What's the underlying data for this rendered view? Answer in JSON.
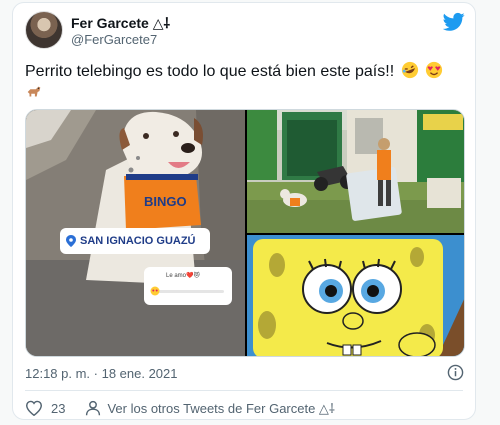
{
  "author": {
    "name": "Fer Garcete △⸸",
    "handle": "@FerGarcete7"
  },
  "tweet": {
    "text": "Perrito telebingo es todo lo que está bien este país!!",
    "emojis": [
      "rolling-on-floor-laughing",
      "heart-eyes",
      "dog"
    ]
  },
  "media": {
    "photo1": {
      "vest_text": "BINGO",
      "location_sticker": "SAN IGNACIO GUAZÚ",
      "poll_sticker": "Le amo❤️😻"
    }
  },
  "meta": {
    "timestamp": "12:18 p. m. · 18 ene. 2021"
  },
  "actions": {
    "like_count": "23",
    "see_more": "Ver los otros Tweets de Fer Garcete △⸸"
  },
  "colors": {
    "twitter_blue": "#1d9bf0",
    "text_primary": "#0f1419",
    "text_secondary": "#536471",
    "border": "#e1e8ed"
  }
}
